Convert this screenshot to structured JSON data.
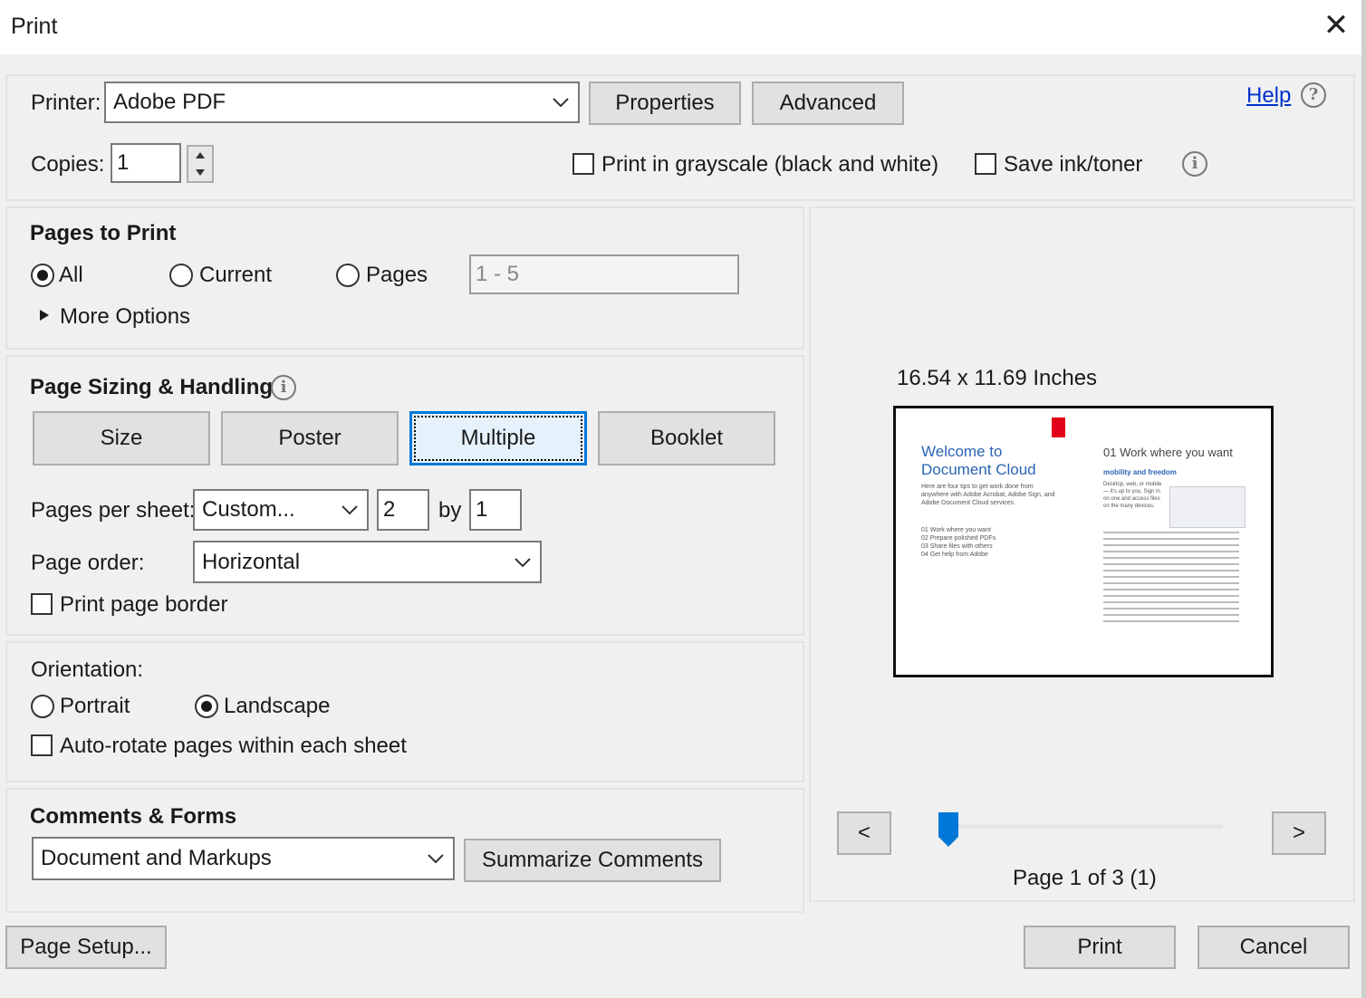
{
  "window": {
    "title": "Print",
    "close_glyph": "✕"
  },
  "printer": {
    "label": "Printer:",
    "selected": "Adobe PDF",
    "properties_label": "Properties",
    "advanced_label": "Advanced",
    "help_label": "Help",
    "copies_label": "Copies:",
    "copies_value": "1",
    "grayscale_label": "Print in grayscale (black and white)",
    "grayscale_checked": false,
    "save_ink_label": "Save ink/toner",
    "save_ink_checked": false
  },
  "pages_to_print": {
    "heading": "Pages to Print",
    "options": [
      "All",
      "Current",
      "Pages"
    ],
    "selected": "All",
    "range_value": "1 - 5",
    "more_options_label": "More Options"
  },
  "page_sizing": {
    "heading": "Page Sizing & Handling",
    "buttons": [
      "Size",
      "Poster",
      "Multiple",
      "Booklet"
    ],
    "active": "Multiple",
    "pages_per_sheet_label": "Pages per sheet:",
    "pages_per_sheet_value": "Custom...",
    "cols_value": "2",
    "by_label": "by",
    "rows_value": "1",
    "page_order_label": "Page order:",
    "page_order_value": "Horizontal",
    "print_border_label": "Print page border",
    "print_border_checked": false
  },
  "orientation": {
    "heading": "Orientation:",
    "portrait_label": "Portrait",
    "landscape_label": "Landscape",
    "selected": "Landscape",
    "auto_rotate_label": "Auto-rotate pages within each sheet",
    "auto_rotate_checked": false
  },
  "comments_forms": {
    "heading": "Comments & Forms",
    "selected": "Document and Markups",
    "summarize_label": "Summarize Comments"
  },
  "preview": {
    "size_text": "16.54 x 11.69 Inches",
    "left_page": {
      "title_line1": "Welcome to",
      "title_line2": "Document Cloud",
      "intro": "Here are four tips to get work done from anywhere with Adobe Acrobat, Adobe Sign, and Adobe Document Cloud services.",
      "toc": [
        "01  Work where you want",
        "02  Prepare polished PDFs",
        "03  Share files with others",
        "04  Get help from Adobe"
      ]
    },
    "right_page": {
      "heading": "01 Work where you want",
      "subheading": "mobility and freedom",
      "body": "Desktop, web, or mobile — it's up to you. Sign in on one and access files on the many devices."
    },
    "prev_label": "<",
    "next_label": ">",
    "page_status": "Page 1 of 3 (1)",
    "slider_position": 0
  },
  "footer": {
    "page_setup_label": "Page Setup...",
    "print_label": "Print",
    "cancel_label": "Cancel"
  },
  "colors": {
    "accent": "#0078d7",
    "link": "#0033cc",
    "adobe_red": "#e1001a",
    "preview_blue": "#2a64b5"
  }
}
